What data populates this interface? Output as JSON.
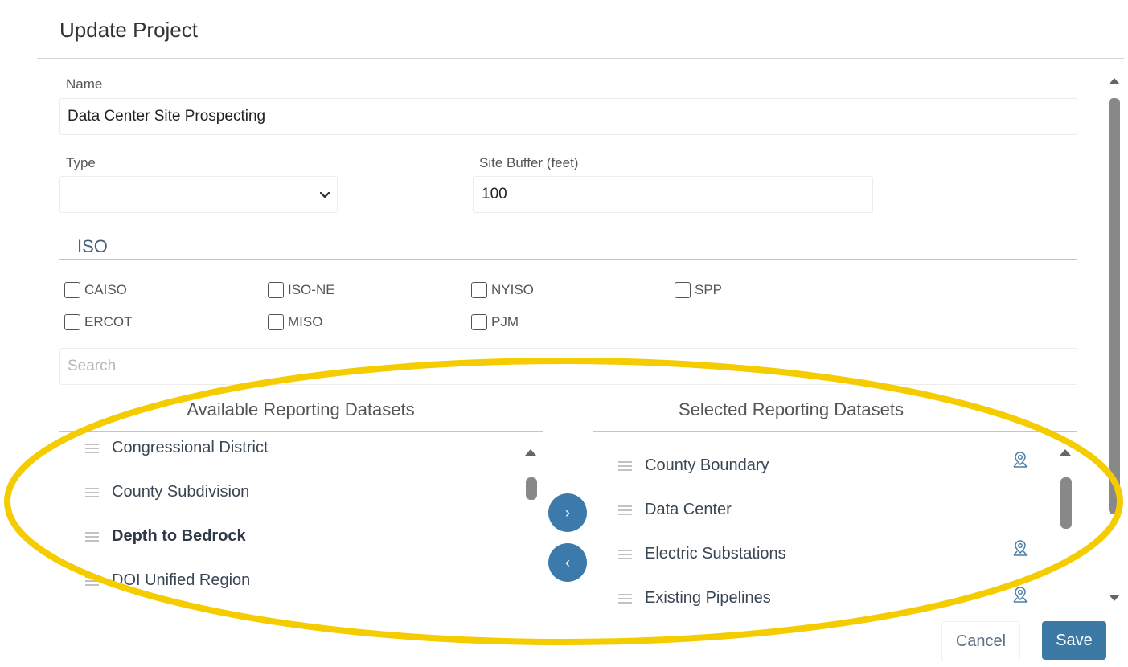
{
  "dialog": {
    "title": "Update Project"
  },
  "form": {
    "name": {
      "label": "Name",
      "value": "Data Center Site Prospecting"
    },
    "type": {
      "label": "Type",
      "value": ""
    },
    "site_buffer": {
      "label": "Site Buffer (feet)",
      "value": "100"
    }
  },
  "iso": {
    "heading": "ISO",
    "options": [
      {
        "label": "CAISO",
        "checked": false
      },
      {
        "label": "ISO-NE",
        "checked": false
      },
      {
        "label": "NYISO",
        "checked": false
      },
      {
        "label": "SPP",
        "checked": false
      },
      {
        "label": "ERCOT",
        "checked": false
      },
      {
        "label": "MISO",
        "checked": false
      },
      {
        "label": "PJM",
        "checked": false
      }
    ]
  },
  "search": {
    "placeholder": "Search"
  },
  "available": {
    "header": "Available Reporting Datasets",
    "items": [
      {
        "label": "Congressional District",
        "bold": false
      },
      {
        "label": "County Subdivision",
        "bold": false
      },
      {
        "label": "Depth to Bedrock",
        "bold": true
      },
      {
        "label": "DOI Unified Region",
        "bold": false
      }
    ]
  },
  "selected": {
    "header": "Selected Reporting Datasets",
    "items": [
      {
        "label": "County Boundary",
        "icon": "map-pin-icon"
      },
      {
        "label": "Data Center",
        "icon": ""
      },
      {
        "label": "Electric Substations",
        "icon": "map-pin-icon"
      },
      {
        "label": "Existing Pipelines",
        "icon": "map-pin-icon"
      }
    ]
  },
  "transfer": {
    "add_symbol": "›",
    "remove_symbol": "‹"
  },
  "footer": {
    "cancel_label": "Cancel",
    "save_label": "Save"
  },
  "colors": {
    "accent": "#3b7aaa",
    "highlight": "#f5cc00"
  }
}
